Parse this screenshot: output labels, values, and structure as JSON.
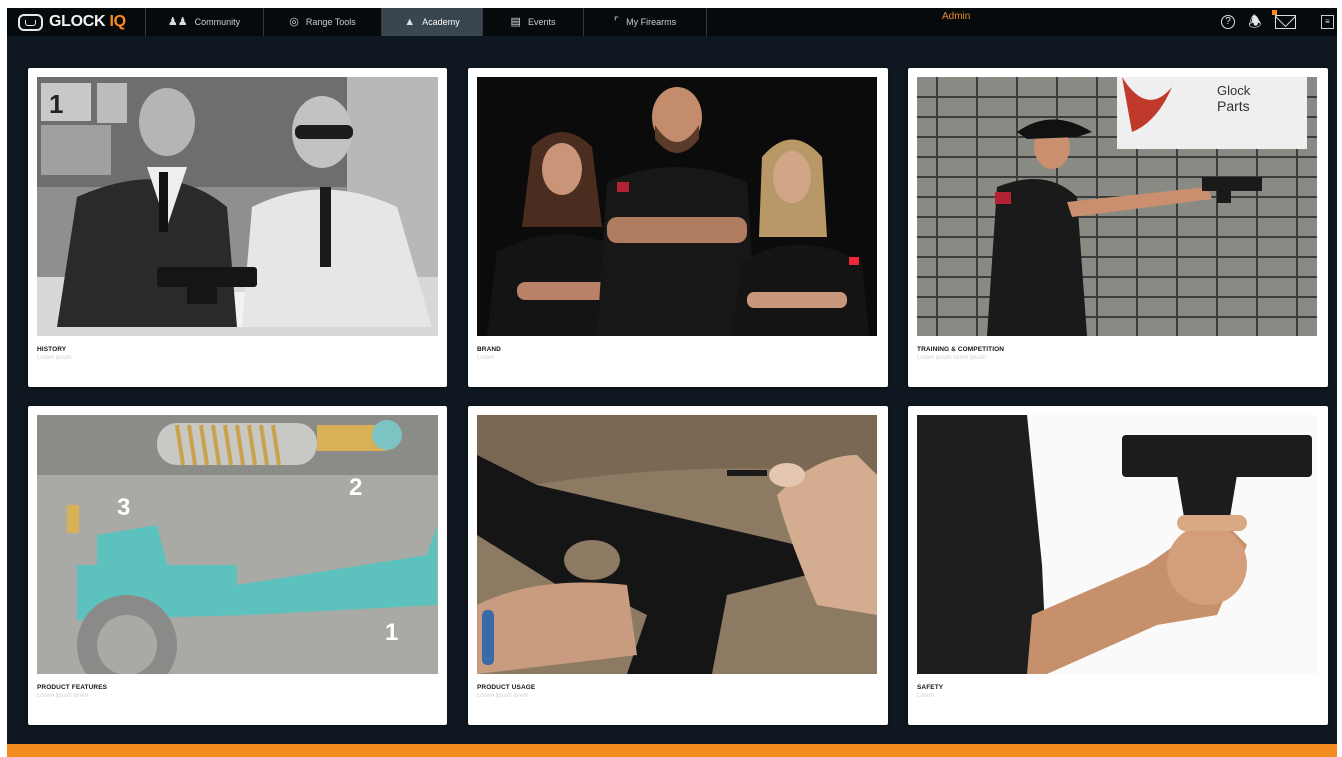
{
  "brand": {
    "logo_main": "GLOCK",
    "logo_accent": "IQ"
  },
  "nav": {
    "tabs": [
      {
        "label": "Community",
        "icon": "community-icon"
      },
      {
        "label": "Range Tools",
        "icon": "target-icon"
      },
      {
        "label": "Academy",
        "icon": "graduation-cap-icon"
      },
      {
        "label": "Events",
        "icon": "calendar-icon"
      },
      {
        "label": "My Firearms",
        "icon": "firearm-icon"
      }
    ],
    "active_tab": "Academy"
  },
  "header": {
    "user_label": "Admin",
    "icons": [
      "help-icon",
      "bell-icon",
      "mail-icon",
      "menu-icon"
    ]
  },
  "cards": [
    {
      "title": "HISTORY",
      "subtitle": "Lorem ipsum"
    },
    {
      "title": "BRAND",
      "subtitle": "Lorem"
    },
    {
      "title": "TRAINING & COMPETITION",
      "subtitle": "Lorem ipsum lorem ipsum"
    },
    {
      "title": "PRODUCT FEATURES",
      "subtitle": "Lorem ipsum lorem"
    },
    {
      "title": "PRODUCT USAGE",
      "subtitle": "Lorem ipsum lorem"
    },
    {
      "title": "SAFETY",
      "subtitle": "Lorem"
    }
  ],
  "photo_labels": {
    "sign_text_1": "Glock",
    "sign_text_2": "Parts",
    "marker_1": "1",
    "marker_2": "2",
    "marker_3": "3"
  },
  "colors": {
    "accent": "#f28c1e",
    "nav_bg": "#060a0d",
    "page_bg": "#0f1820",
    "active_tab": "#39454f"
  }
}
